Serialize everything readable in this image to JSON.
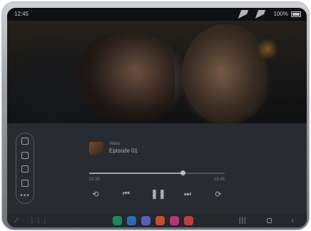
{
  "status_bar": {
    "time": "12:45",
    "battery": "100%"
  },
  "media": {
    "type_label": "Video",
    "title": "Episode 01",
    "time_elapsed": "02:35",
    "time_total": "03:45",
    "progress": 0.69
  },
  "controls": {
    "rewind_icon": "rewind-10-icon",
    "prev_icon": "skip-previous-icon",
    "pause_icon": "pause-icon",
    "next_icon": "skip-next-icon",
    "forward_icon": "forward-10-icon"
  },
  "dock_apps": [
    {
      "name": "phone-app",
      "color": "#1fa06a"
    },
    {
      "name": "messages-app",
      "color": "#3b7bd6"
    },
    {
      "name": "chat-app",
      "color": "#6b6fd1"
    },
    {
      "name": "store-app",
      "color": "#e45a39"
    },
    {
      "name": "flower-app",
      "color": "#d6408f"
    },
    {
      "name": "camera-app",
      "color": "#e0474b"
    }
  ],
  "icons": {
    "rail_1": "window-icon",
    "rail_2": "document-icon",
    "rail_3": "screenshot-icon",
    "rail_4": "gallery-icon",
    "rail_more": "more-icon",
    "dock_pin": "pin-icon",
    "dock_grid": "apps-grid-icon",
    "nav_recents": "recents-icon",
    "nav_home": "home-icon",
    "nav_back": "back-icon"
  }
}
